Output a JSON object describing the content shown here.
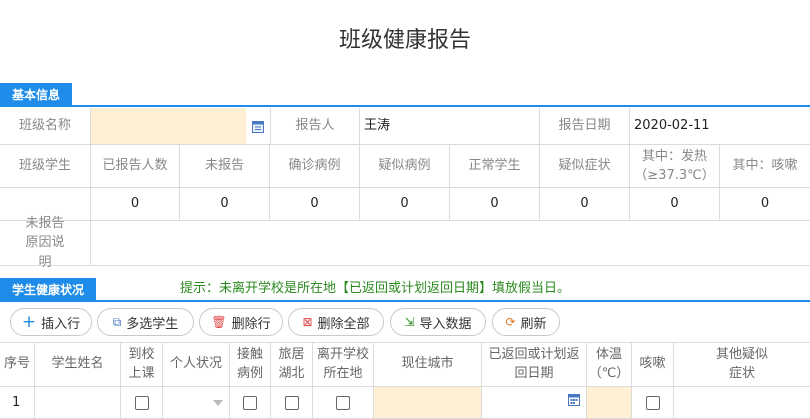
{
  "page_title": "班级健康报告",
  "basic": {
    "tab": "基本信息",
    "class_name_label": "班级名称",
    "class_name_value": "",
    "calendar_icon": "calendar-icon",
    "reporter_label": "报告人",
    "reporter_value": "王涛",
    "date_label": "报告日期",
    "date_value": "2020-02-11",
    "stats_label": "班级学生",
    "stats_headers": [
      "已报告人数",
      "未报告",
      "确诊病例",
      "疑似病例",
      "正常学生",
      "疑似症状",
      "其中：发热（≥37.3℃）",
      "其中：咳嗽"
    ],
    "stats_values": [
      "0",
      "0",
      "0",
      "0",
      "0",
      "0",
      "0",
      "0"
    ],
    "unreported_label": "未报告原因说明",
    "unreported_value": ""
  },
  "health": {
    "tab": "学生健康状况",
    "hint": "提示：未离开学校是所在地【已返回或计划返回日期】填放假当日。",
    "buttons": [
      {
        "label": "插入行",
        "icon": "plus-icon"
      },
      {
        "label": "多选学生",
        "icon": "multi-select-icon"
      },
      {
        "label": "删除行",
        "icon": "trash-icon"
      },
      {
        "label": "删除全部",
        "icon": "delete-all-icon"
      },
      {
        "label": "导入数据",
        "icon": "import-icon"
      },
      {
        "label": "刷新",
        "icon": "refresh-icon"
      }
    ],
    "columns": [
      "序号",
      "学生姓名",
      "到校上课",
      "个人状况",
      "接触病例",
      "旅居湖北",
      "离开学校所在地",
      "现住城市",
      "已返回或计划返回日期",
      "体温（℃）",
      "咳嗽",
      "其他疑似症状"
    ],
    "rows": [
      {
        "index": "1"
      }
    ]
  },
  "colors": {
    "accent": "#1e8ce8",
    "input_highlight": "#fff0d4",
    "hint": "#2a8a1e"
  }
}
